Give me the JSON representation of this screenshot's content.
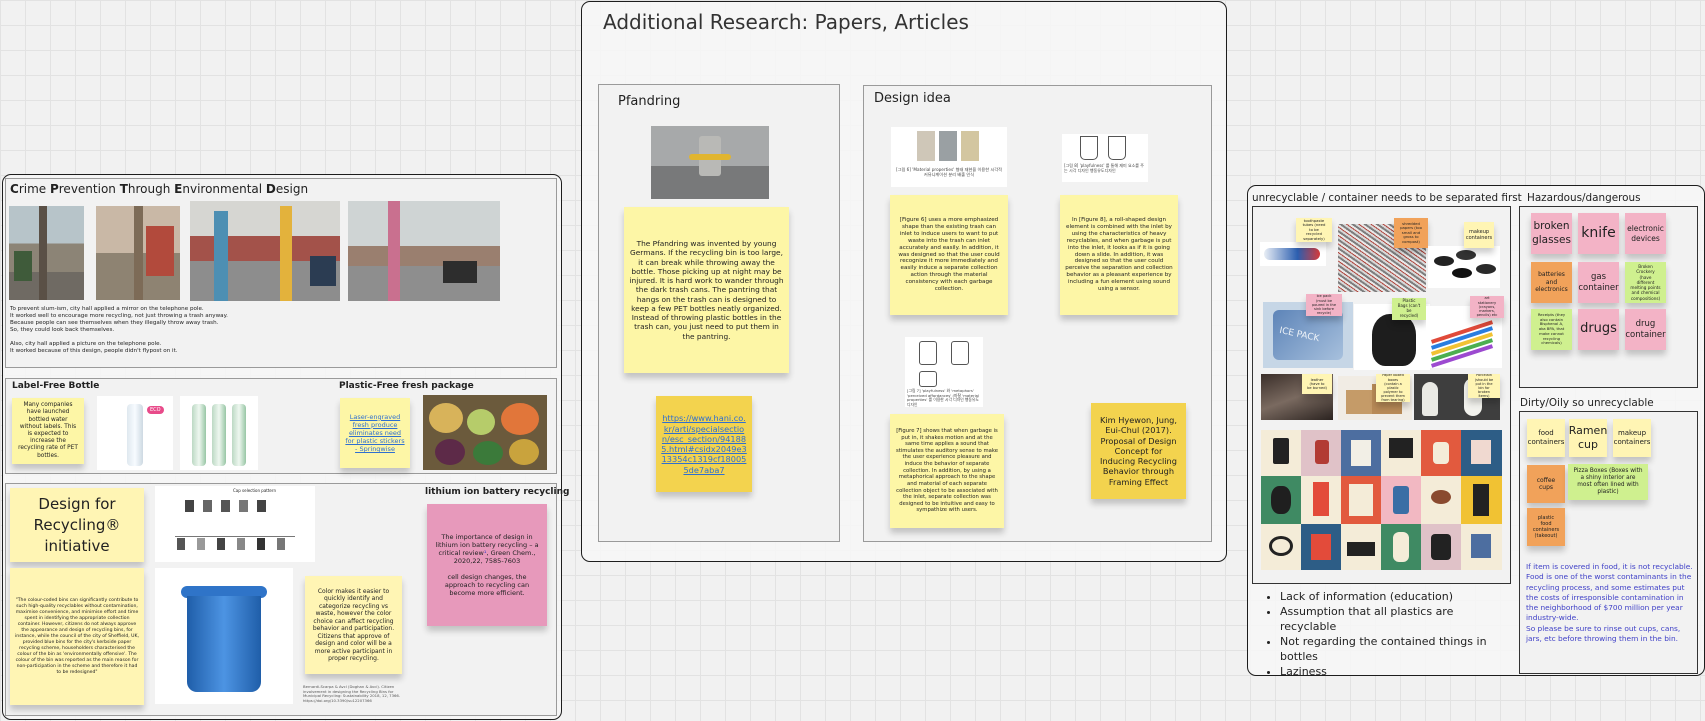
{
  "research": {
    "title": "Additional Research: Papers, Articles",
    "pfandring": {
      "title": "Pfandring",
      "note": "The Pfandring was invented by young Germans. If the recycling bin is too large, it can break while throwing away the bottle. Those picking up at night may be injured. It is hard work to wander through the dark trash cans. The pantring that hangs on the trash can is designed to keep a few PET bottles neatly organized. Instead of throwing plastic bottles in the trash can, you just need to put them in the pantring.",
      "link": "https://www.hani.co.kr/arti/specialsection/esc_section/941885.html#csidx2049e313354c1319cf180055de7aba7"
    },
    "design_idea": {
      "title": "Design idea",
      "caption1": "[그림 6] 'Material properties' 형태 재현을 이용한 시각적 커뮤니케이션 분리 배출 인식",
      "caption2": "[그림 8] 'playfulness' 를 통해 재미 요소를 주는 시각 디자인 행동유도디자인",
      "caption3": "[그림 7] 'playfulness' 와 'metaphors' 'perceived affordances' (마찰 'material properties' 를 이용한 시각 디자인 행동유도디자인",
      "note1": "[Figure 6] uses a more emphasized shape than the existing trash can inlet to induce users to want to put waste into the trash can inlet accurately and easily. In addition, it was designed so that the user could recognize it more immediately and easily induce a separate collection action through the material consistency with each garbage collection.",
      "note2": "In [Figure 8], a roll-shaped design element is combined with the inlet by using the characteristics of heavy recyclables, and when garbage is put into the inlet, it looks as if it is going down a slide. In addition, it was designed so that the user could perceive the separation and collection behavior as a pleasant experience by including a fun element using sound using a sensor.",
      "note3": "[Figure 7] shows that when garbage is put in, it shakes motion and at the same time applies a sound that stimulates the auditory sense to make the user experience pleasure and induce the behavior of separate collection. In addition, by using a metaphorical approach to the shape and material of each separate collection object to be associated with the inlet, separate collection was designed to be intuitive and easy to sympathize with users.",
      "citation": "Kim Hyewon, Jung, Eui-Chul (2017). Proposal of Design Concept for Inducing Recycling Behavior through Framing Effect"
    }
  },
  "left": {
    "cpted": {
      "title_parts": [
        {
          "b": "C",
          "t": "rime "
        },
        {
          "b": "P",
          "t": "revention "
        },
        {
          "b": "T",
          "t": "hrough "
        },
        {
          "b": "E",
          "t": "nvironmental "
        },
        {
          "b": "D",
          "t": "esign"
        }
      ],
      "lines": [
        "To prevent slum-ism, city hall applied a mirror on the telephone pole.",
        "It worked well to encourage more recycling, not just throwing a trash anyway.",
        "Because people can see themselves when they illegally throw away trash.",
        "So, they could look back themselves.",
        "",
        "Also, city hall applied a picture on the telephone pole.",
        "It worked because of this design, people didn't flypost on it."
      ]
    },
    "label_free": {
      "title": "Label-Free Bottle",
      "note": "Many companies have launched bottled water without labels. This is expected to increase the recycling rate of PET bottles.",
      "eco": "ECO"
    },
    "plastic_free": {
      "title": "Plastic-Free fresh package",
      "link": "Laser-engraved fresh produce eliminates need for plastic stickers - Springwise"
    },
    "design_for": {
      "title": "Design for Recycling® initiative",
      "quote": "\"The colour-coded bins can significantly contribute to such high-quality recyclables without contamination, maximise convenience, and minimise effort and time spent in identifying the appropriate collection container. However, citizens do not always approve the appearance and design of recycling bins, for instance, while the council of the city of Sheffield, UK, provided blue bins for the city's kerbside paper recycling scheme, householders characterised the colour of the bin as 'environmentally offensive'. The colour of the bin was reported as the main reason for non-participation in the scheme and therefore it had to be redesigned\"",
      "chart_title": "Cap selection pattern",
      "color_note": "Color makes it easier to quickly identify and categorize recycling vs waste, however the color choice can affect recycling behavior and participation. Citizens that approve of design and color will be a more active participant in proper recycling.",
      "source": "Bernardi-Scarpa & Avcl (Doghan & Avci). Citizen involvement in designing the Recycling Bins for Municipal Recycling: Sustainability 2018, 12, 7366. https://doi.org/10.3390/su12207366"
    },
    "lithium": {
      "title": "lithium ion battery recycling",
      "note_a": "The importance of design in lithium ion battery recycling – a critical review",
      "note_b": ", Green Chem., 2020,22, 7585-7603",
      "note_c": "cell design changes, the approach to recycling can become more efficient."
    }
  },
  "right": {
    "unrecyclable": {
      "title": "unrecyclable / container needs to be separated first",
      "n1": "toothpaste tubes (need to be recycled separately)",
      "n2": "shredded papers (too small and gross to compost)",
      "n3": "makeup containers",
      "n4": "ice pack (must be poured in the sink before recycle)",
      "n5": "Plastic Bags (can't be recycled)",
      "n6": "art stationery (crayons, markers, pencils) etc",
      "n7": "leather (have to be burned)",
      "n8": "Paper boxed boxes (contain a plastic polymer to prevent them from tearing)",
      "n9": "Porcelain (should be put in the bin for broken items)",
      "ice": "ICE PACK"
    },
    "bullets": [
      "Lack of information (education)",
      "Assumption that all plastics are recyclable",
      "Not regarding the contained things in bottles",
      "Laziness"
    ],
    "hazard": {
      "title": "Hazardous/dangerous",
      "broken": "broken glasses",
      "knife": "knife",
      "elec": "electronic devices",
      "batt": "batteries and electronics",
      "gas": "gas container",
      "crock": "Broken Crockery (have different melting points and chemical compositions)",
      "receipt": "Receipts (they also contain Bisphenol A, aka BPA, that make cannot recycling chemicals)",
      "drugs": "drugs",
      "drugc": "drug container"
    },
    "dirty": {
      "title": "Dirty/Oily so unrecyclable",
      "food": "food containers",
      "ramen": "Ramen cup",
      "makeup": "makeup containers",
      "coffee": "coffee cups",
      "pizza": "Pizza Boxes (Boxes with a shiny interior are most often lined with plastic)",
      "plastic": "plastic food containers (takeout)",
      "para": "If item is covered in food, it is not recyclable. Food is one of the worst contaminants in the recycling process, and some estimates put the costs of irresponsible contamination in the neighborhood of $700 million per year industry-wide.\nSo please be sure to rinse out cups, cans, jars, etc before throwing them in the bin."
    }
  },
  "colors": {
    "yellow": "#fdf6a6",
    "gold": "#f3d34e",
    "pink": "#f3b3c6",
    "orange": "#f1a25a",
    "green": "#cff08f",
    "magenta": "#e799bb",
    "link": "#3f40c7"
  }
}
